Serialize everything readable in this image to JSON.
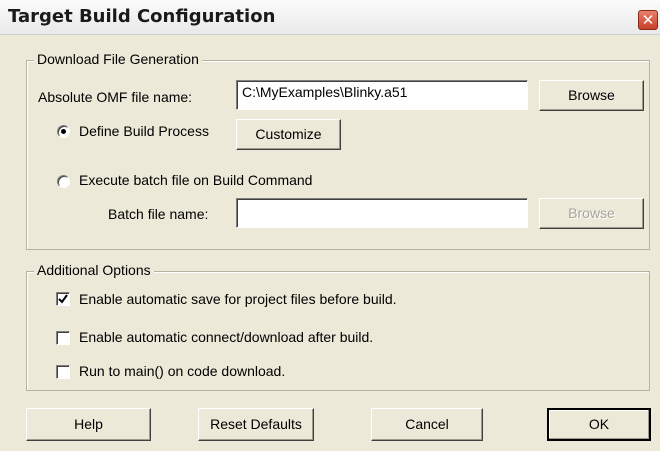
{
  "window": {
    "title": "Target Build Configuration",
    "close_glyph": "✕"
  },
  "download_group": {
    "label": "Download File Generation",
    "omf_label": "Absolute OMF file name:",
    "omf_value": "C:\\MyExamples\\Blinky.a51",
    "browse_label": "Browse",
    "define_build_label": "Define Build Process",
    "define_build_checked": true,
    "customize_label": "Customize",
    "execute_batch_label": "Execute batch file on Build Command",
    "execute_batch_checked": false,
    "batch_file_label": "Batch file name:",
    "batch_file_value": "",
    "batch_browse_label": "Browse"
  },
  "options_group": {
    "label": "Additional Options",
    "items": [
      {
        "label": "Enable automatic save for project files before build.",
        "checked": true
      },
      {
        "label": "Enable automatic connect/download after build.",
        "checked": false
      },
      {
        "label": "Run to main() on code download.",
        "checked": false
      }
    ]
  },
  "footer": {
    "help_label": "Help",
    "reset_label": "Reset Defaults",
    "cancel_label": "Cancel",
    "ok_label": "OK"
  }
}
